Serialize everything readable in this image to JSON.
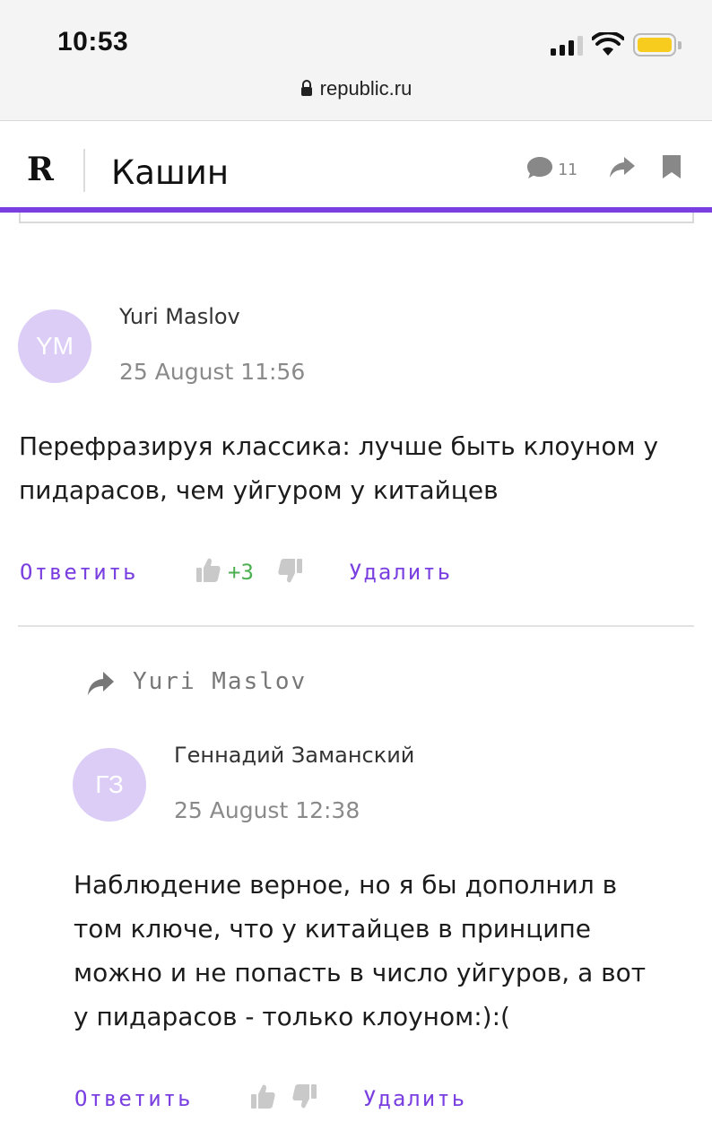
{
  "status_bar": {
    "time": "10:53",
    "url": "republic.ru",
    "battery_color": "#f7cc1f"
  },
  "header": {
    "logo": "R",
    "section": "Кашин",
    "comment_count": "11"
  },
  "colors": {
    "accent": "#7a3fe0",
    "avatar_bg": "#dccdf7",
    "score_positive": "#4caf50"
  },
  "comments": [
    {
      "initials": "YM",
      "author": "Yuri Maslov",
      "date": "25 August 11:56",
      "text_lines": [
        "Перефразируя классика: лучше быть клоуном у",
        "пидарасов, чем уйгуром у китайцев"
      ],
      "reply_label": "Ответить",
      "score": "+3",
      "delete_label": "Удалить"
    },
    {
      "reply_to": "Yuri Maslov",
      "initials": "ГЗ",
      "author": "Геннадий Заманский",
      "date": "25 August 12:38",
      "text_lines": [
        "Наблюдение верное, но я бы дополнил в",
        "том ключе, что у китайцев в принципе",
        "можно и не попасть в число уйгуров, а вот",
        "у пидарасов - только клоуном:):("
      ],
      "reply_label": "Ответить",
      "delete_label": "Удалить"
    }
  ]
}
